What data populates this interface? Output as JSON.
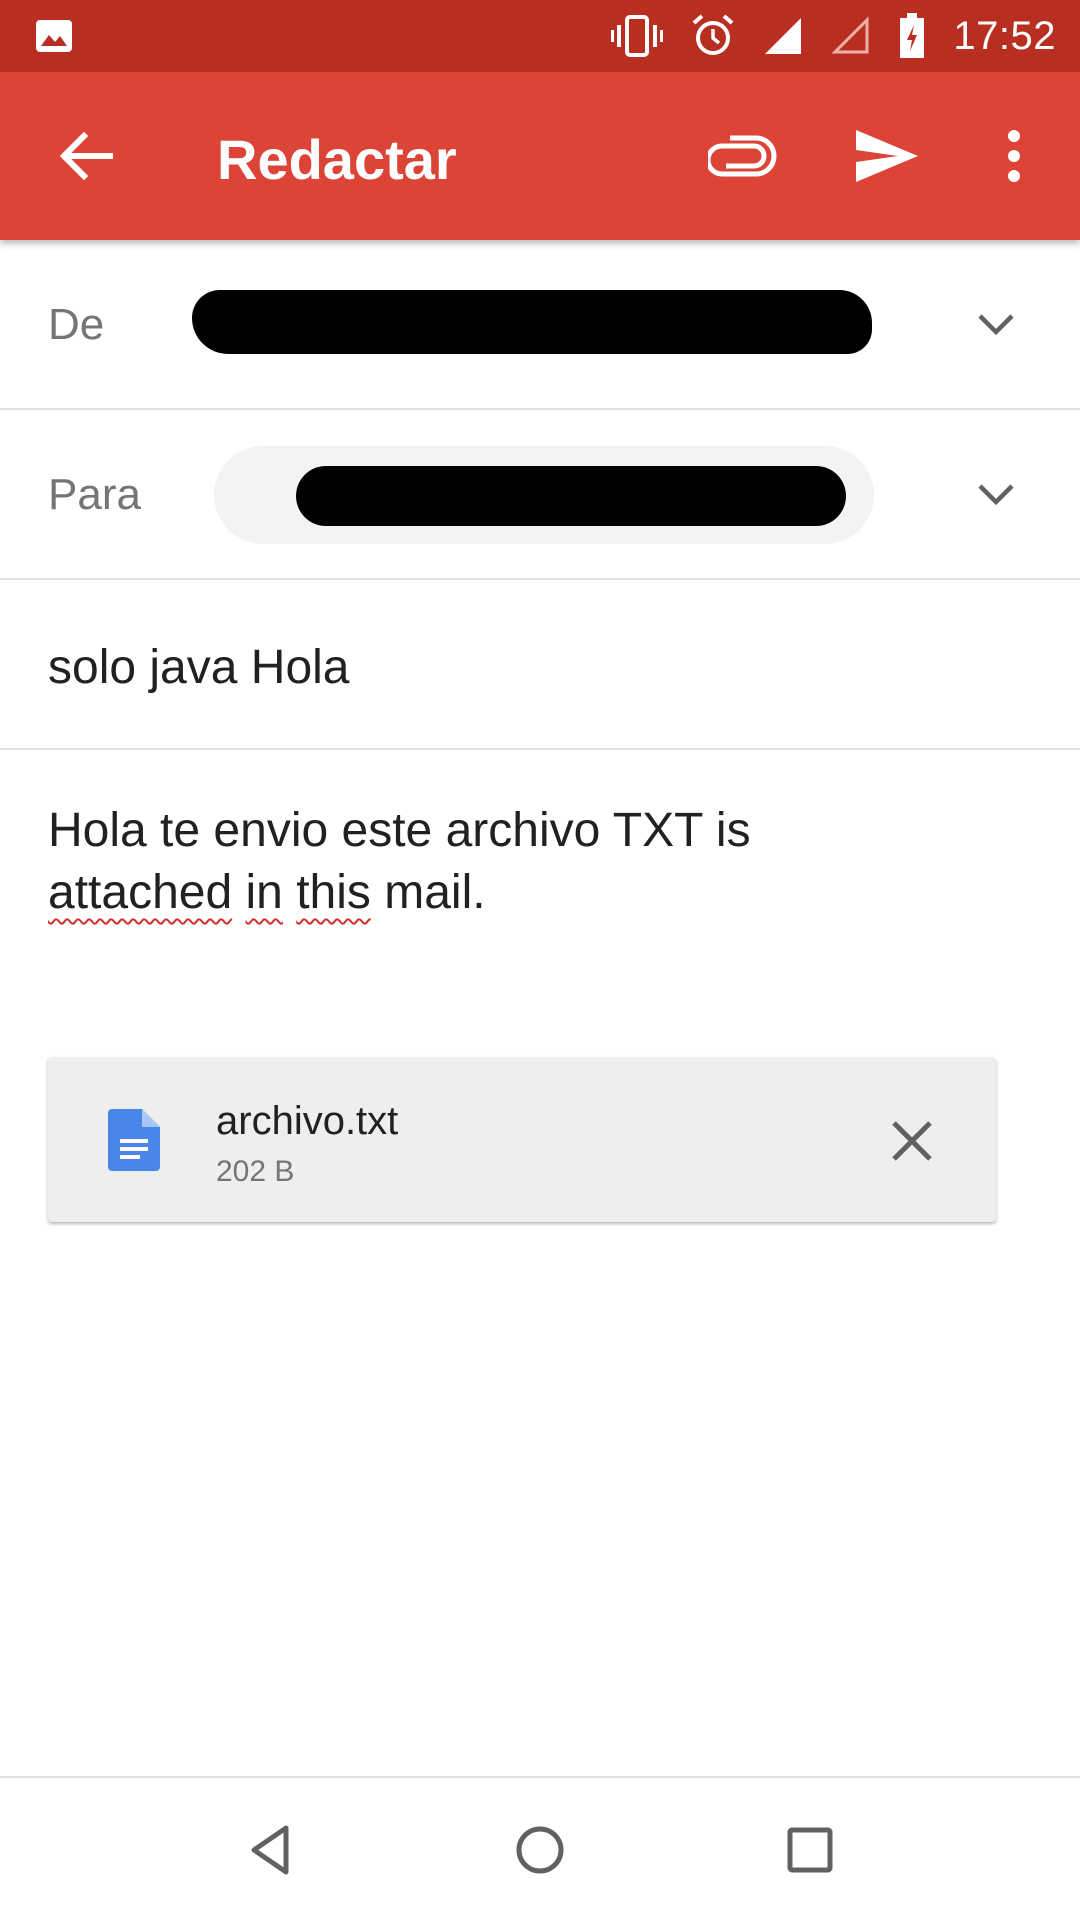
{
  "status_bar": {
    "time": "17:52",
    "icons": [
      "image-notification-icon",
      "vibrate-icon",
      "alarm-icon",
      "signal-icon",
      "signal-empty-icon",
      "battery-charging-icon"
    ]
  },
  "app_bar": {
    "title": "Redactar",
    "icons": [
      "arrow-back-icon",
      "paperclip-icon",
      "send-icon",
      "more-vert-icon"
    ],
    "background": "#db4437",
    "status_background": "#b82f22"
  },
  "compose": {
    "from_label": "De",
    "to_label": "Para",
    "subject": "solo java Hola",
    "body_line1": "Hola te envio este archivo TXT is",
    "body_line2_words": [
      "attached",
      "in",
      "this",
      "mail."
    ]
  },
  "attachment": {
    "name": "archivo.txt",
    "size": "202 B",
    "icon": "document-icon",
    "icon_color": "#4a86e8"
  },
  "nav_bar": {
    "icons": [
      "nav-back-icon",
      "nav-home-icon",
      "nav-recents-icon"
    ]
  }
}
